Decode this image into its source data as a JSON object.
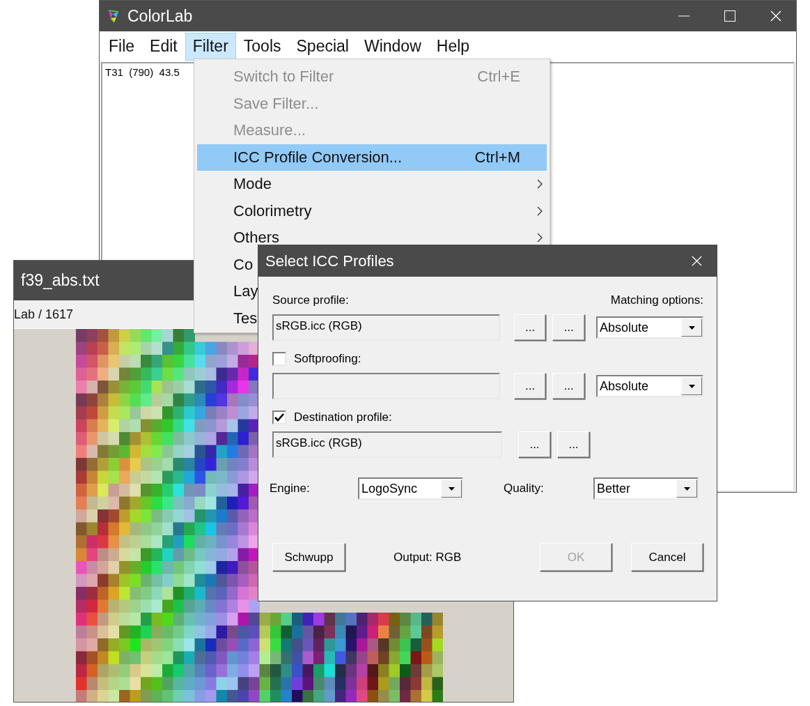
{
  "main_window": {
    "title": "ColorLab",
    "menu": [
      {
        "label": "File",
        "selected": false
      },
      {
        "label": "Edit",
        "selected": false
      },
      {
        "label": "Filter",
        "selected": true
      },
      {
        "label": "Tools",
        "selected": false
      },
      {
        "label": "Special",
        "selected": false
      },
      {
        "label": "Window",
        "selected": false
      },
      {
        "label": "Help",
        "selected": false
      }
    ],
    "content_text": "T31  (790)  43.5"
  },
  "document_window": {
    "title": "f39_abs.txt",
    "info": "Lab / 1617"
  },
  "filter_menu": {
    "items": [
      {
        "label": "Switch to Filter",
        "shortcut": "Ctrl+E",
        "disabled": true,
        "highlighted": false,
        "submenu": false
      },
      {
        "label": "Save Filter...",
        "disabled": true,
        "highlighted": false,
        "submenu": false
      },
      {
        "label": "Measure...",
        "disabled": true,
        "highlighted": false,
        "submenu": false
      },
      {
        "label": "ICC Profile Conversion...",
        "shortcut": "Ctrl+M",
        "disabled": false,
        "highlighted": true,
        "submenu": false
      },
      {
        "label": "Mode",
        "disabled": false,
        "highlighted": false,
        "submenu": true
      },
      {
        "label": "Colorimetry",
        "disabled": false,
        "highlighted": false,
        "submenu": true
      },
      {
        "label": "Others",
        "disabled": false,
        "highlighted": false,
        "submenu": true
      },
      {
        "label": "Co",
        "disabled": false,
        "highlighted": false,
        "submenu": false
      },
      {
        "label": "Lay",
        "disabled": false,
        "highlighted": false,
        "submenu": false
      },
      {
        "label": "Tes",
        "disabled": false,
        "highlighted": false,
        "submenu": false
      }
    ]
  },
  "dialog": {
    "title": "Select ICC Profiles",
    "matching_label": "Matching options:",
    "profiles": [
      {
        "kind": "plain",
        "label": "Source profile:",
        "value": "sRGB.icc (RGB)",
        "buttons": [
          "...",
          "..."
        ],
        "matching": "Absolute"
      },
      {
        "kind": "checkbox",
        "label": "Softproofing:",
        "checked": false,
        "buttons": [
          "...",
          "..."
        ],
        "matching": "Absolute"
      },
      {
        "kind": "checkbox",
        "label": "Destination profile:",
        "checked": true,
        "value": "sRGB.icc (RGB)",
        "buttons": [
          "...",
          "..."
        ]
      }
    ],
    "engine": {
      "label": "Engine:",
      "value": "LogoSync"
    },
    "quality": {
      "label": "Quality:",
      "value": "Better"
    },
    "output": "Output: RGB",
    "buttons": [
      {
        "label": "Schwupp",
        "disabled": false
      },
      {
        "label": "OK",
        "disabled": true
      },
      {
        "label": "Cancel",
        "disabled": false
      }
    ]
  }
}
